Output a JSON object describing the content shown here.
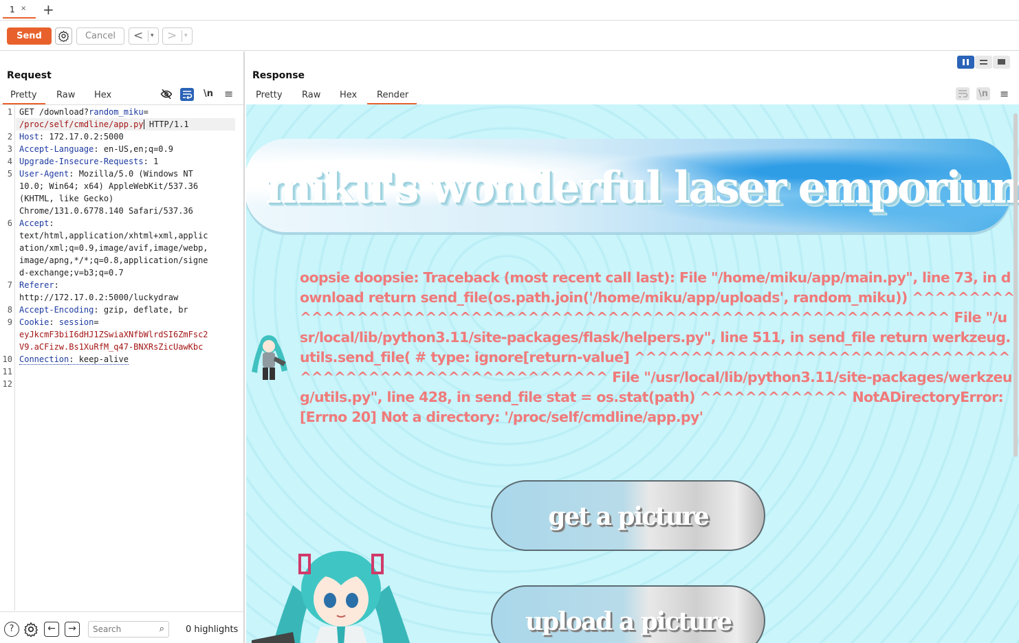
{
  "tabs": {
    "active_label": "1",
    "close_glyph": "×",
    "new_tab_glyph": "+"
  },
  "toolbar": {
    "send_label": "Send",
    "cancel_label": "Cancel",
    "back_glyph": "<",
    "forward_glyph": ">",
    "dropdown_glyph": "▾",
    "accent_color": "#e8612c"
  },
  "request": {
    "title": "Request",
    "tabs": [
      "Pretty",
      "Raw",
      "Hex"
    ],
    "active_tab": "Pretty",
    "icons": [
      "eye-slash-icon",
      "wrap-lines-icon",
      "newline-icon",
      "menu-icon"
    ],
    "newline_glyph": "\\n",
    "menu_glyph": "≡",
    "line_numbers": [
      "1",
      "2",
      "3",
      "4",
      "5",
      "6",
      "7",
      "8",
      "9",
      "10",
      "11",
      "12"
    ],
    "lines": {
      "l1a": "GET /download?",
      "l1b": "random_miku",
      "l1c": "=",
      "l1d": "/proc/self/cmdline/app.py",
      "l1e": " HTTP/1.1",
      "l2k": "Host",
      "l2v": ": 172.17.0.2:5000",
      "l3k": "Accept-Language",
      "l3v": ": en-US,en;q=0.9",
      "l4k": "Upgrade-Insecure-Requests",
      "l4v": ": 1",
      "l5k": "User-Agent",
      "l5v": ": Mozilla/5.0 (Windows NT",
      "l5w1": "10.0; Win64; x64) AppleWebKit/537.36",
      "l5w2": "(KHTML, like Gecko)",
      "l5w3": "Chrome/131.0.6778.140 Safari/537.36",
      "l6k": "Accept",
      "l6v": ":",
      "l6w1": "text/html,application/xhtml+xml,applic",
      "l6w2": "ation/xml;q=0.9,image/avif,image/webp,",
      "l6w3": "image/apng,*/*;q=0.8,application/signe",
      "l6w4": "d-exchange;v=b3;q=0.7",
      "l7k": "Referer",
      "l7v": ":",
      "l7w1": "http://172.17.0.2:5000/luckydraw",
      "l8k": "Accept-Encoding",
      "l8v": ": gzip, deflate, br",
      "l9k": "Cookie",
      "l9v": ": ",
      "l9n": "session",
      "l9e": "=",
      "l9w1": "eyJkcmF3biI6dHJ1ZSwiaXNfbWlrdSI6ZmFsc2",
      "l9w2": "V9.aCFizw.Bs1XuRfM_q47-BNXRsZicUawKbc",
      "l10k": "Connection",
      "l10v": ": keep-alive"
    },
    "search_placeholder": "Search",
    "highlights": "0 highlights"
  },
  "response": {
    "title": "Response",
    "tabs": [
      "Pretty",
      "Raw",
      "Hex",
      "Render"
    ],
    "active_tab": "Render",
    "newline_glyph": "\\n",
    "menu_glyph": "≡",
    "rendered": {
      "heading": "miku's wonderful laser emporium",
      "error": "oopsie doopsie: Traceback (most recent call last): File \"/home/miku/app/main.py\", line 73, in download return send_file(os.path.join('/home/miku/app/uploads', random_miku)) ^^^^^^^^^^^^^^^^^^^^^^^^^^^^^^^^^^^^^^^^^^^^^^^^^^^^^^^^^^^^^^^^^^ File \"/usr/local/lib/python3.11/site-packages/flask/helpers.py\", line 511, in send_file return werkzeug.utils.send_file( # type: ignore[return-value] ^^^^^^^^^^^^^^^^^^^^^^^^^^^^^^^^^^^^^^^^^^^^^^^^^^^^^^^^^^^^ File \"/usr/local/lib/python3.11/site-packages/werkzeug/utils.py\", line 428, in send_file stat = os.stat(path) ^^^^^^^^^^^^^ NotADirectoryError: [Errno 20] Not a directory: '/proc/self/cmdline/app.py'",
      "button1": "get a picture",
      "button2": "upload a picture",
      "error_color": "#f07a7a",
      "background_color": "#c9f5fb"
    }
  }
}
